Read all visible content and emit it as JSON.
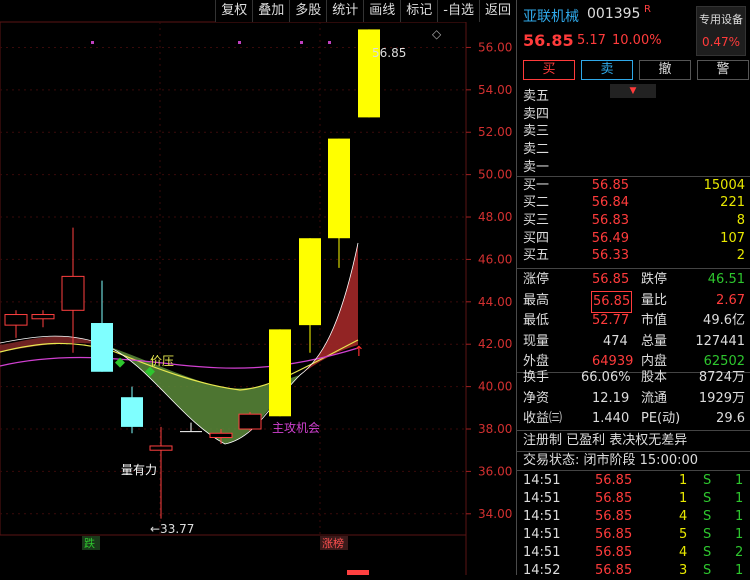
{
  "toolbar": {
    "items": [
      "复权",
      "叠加",
      "多股",
      "统计",
      "画线",
      "标记",
      "-自选",
      "返回"
    ]
  },
  "stock": {
    "name": "亚联机械",
    "code": "001395",
    "flag": "R",
    "price": "56.85",
    "change": "5.17",
    "change_pct": "10.00%",
    "special_label": "专用设备",
    "special_value": "0.47%"
  },
  "actions": {
    "buy": "买",
    "sell": "卖",
    "cancel": "撤",
    "alert": "警"
  },
  "asks": [
    {
      "label": "卖五",
      "price": "",
      "vol": ""
    },
    {
      "label": "卖四",
      "price": "",
      "vol": ""
    },
    {
      "label": "卖三",
      "price": "",
      "vol": ""
    },
    {
      "label": "卖二",
      "price": "",
      "vol": ""
    },
    {
      "label": "卖一",
      "price": "",
      "vol": ""
    }
  ],
  "bids": [
    {
      "label": "买一",
      "price": "56.85",
      "vol": "15004"
    },
    {
      "label": "买二",
      "price": "56.84",
      "vol": "221"
    },
    {
      "label": "买三",
      "price": "56.83",
      "vol": "8"
    },
    {
      "label": "买四",
      "price": "56.49",
      "vol": "107"
    },
    {
      "label": "买五",
      "price": "56.33",
      "vol": "2"
    }
  ],
  "stats": {
    "limit_up_label": "涨停",
    "limit_up": "56.85",
    "limit_down_label": "跌停",
    "limit_down": "46.51",
    "high_label": "最高",
    "high": "56.85",
    "ratio_label": "量比",
    "ratio": "2.67",
    "low_label": "最低",
    "low": "52.77",
    "mcap_label": "市值",
    "mcap": "49.6亿",
    "cur_vol_label": "现量",
    "cur_vol": "474",
    "total_vol_label": "总量",
    "total_vol": "127441",
    "outer_label": "外盘",
    "outer": "64939",
    "inner_label": "内盘",
    "inner": "62502"
  },
  "fundamentals": {
    "turnover_label": "换手",
    "turnover": "66.06%",
    "capital_label": "股本",
    "capital": "8724万",
    "nav_label": "净资",
    "nav": "12.19",
    "float_label": "流通",
    "float": "1929万",
    "eps_label": "收益㈢",
    "eps": "1.440",
    "pe_label": "PE(动)",
    "pe": "29.6",
    "tags": "注册制 已盈利 表决权无差异",
    "status": "交易状态: 闭市阶段 15:00:00"
  },
  "ticks": [
    {
      "time": "14:51",
      "price": "56.85",
      "vol": "1",
      "side": "S",
      "num": "1"
    },
    {
      "time": "14:51",
      "price": "56.85",
      "vol": "1",
      "side": "S",
      "num": "1"
    },
    {
      "time": "14:51",
      "price": "56.85",
      "vol": "4",
      "side": "S",
      "num": "1"
    },
    {
      "time": "14:51",
      "price": "56.85",
      "vol": "5",
      "side": "S",
      "num": "1"
    },
    {
      "time": "14:51",
      "price": "56.85",
      "vol": "4",
      "side": "S",
      "num": "2"
    },
    {
      "time": "14:52",
      "price": "56.85",
      "vol": "3",
      "side": "S",
      "num": "1"
    }
  ],
  "chart_data": {
    "type": "candlestick",
    "y_ticks": [
      "56.00",
      "54.00",
      "52.00",
      "50.00",
      "48.00",
      "46.00",
      "44.00",
      "42.00",
      "40.00",
      "38.00",
      "36.00",
      "34.00"
    ],
    "ylim": [
      33.0,
      57.2
    ],
    "candles": [
      {
        "open": 42.9,
        "close": 43.4,
        "high": 43.6,
        "low": 42.3,
        "color": "hollow-red"
      },
      {
        "open": 43.2,
        "close": 43.4,
        "high": 43.6,
        "low": 42.8,
        "color": "hollow-red"
      },
      {
        "open": 43.6,
        "close": 45.2,
        "high": 47.5,
        "low": 41.6,
        "color": "hollow-red"
      },
      {
        "open": 43.0,
        "close": 40.7,
        "high": 45.0,
        "low": 40.7,
        "color": "cyan"
      },
      {
        "open": 39.5,
        "close": 38.1,
        "high": 40.0,
        "low": 37.8,
        "color": "cyan"
      },
      {
        "open": 37.2,
        "close": 37.0,
        "high": 38.1,
        "low": 33.77,
        "color": "hollow-red"
      },
      {
        "open": 37.9,
        "close": 37.9,
        "high": 38.3,
        "low": 37.9,
        "color": "white"
      },
      {
        "open": 37.6,
        "close": 37.8,
        "high": 38.0,
        "low": 37.3,
        "color": "hollow-red"
      },
      {
        "open": 38.0,
        "close": 38.7,
        "high": 38.8,
        "low": 37.9,
        "color": "hollow-red"
      },
      {
        "open": 38.6,
        "close": 42.7,
        "high": 42.7,
        "low": 38.6,
        "color": "yellow"
      },
      {
        "open": 42.9,
        "close": 47.0,
        "high": 47.0,
        "low": 41.6,
        "color": "yellow"
      },
      {
        "open": 47.0,
        "close": 51.7,
        "high": 51.7,
        "low": 45.6,
        "color": "yellow"
      },
      {
        "open": 52.7,
        "close": 56.85,
        "high": 56.85,
        "low": 52.7,
        "color": "yellow"
      }
    ],
    "annotations": [
      "56.85",
      "33.77",
      "价压",
      "量有力",
      "主攻机会",
      "跌",
      "涨榜"
    ]
  }
}
